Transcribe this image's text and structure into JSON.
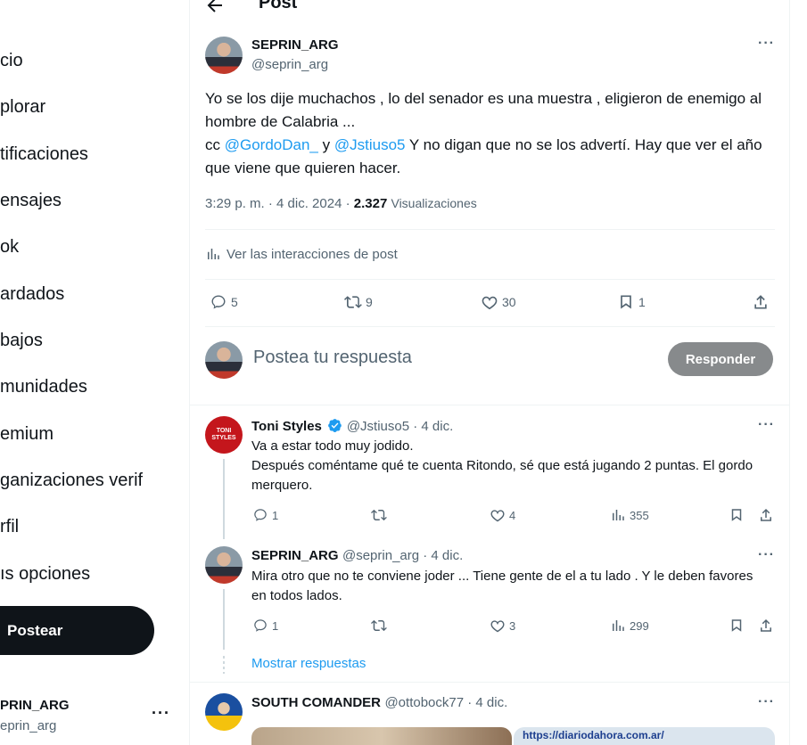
{
  "sidebar": {
    "items": [
      {
        "label": "Inicio",
        "visible": "cio"
      },
      {
        "label": "Explorar",
        "visible": "plorar"
      },
      {
        "label": "Notificaciones",
        "visible": "tificaciones"
      },
      {
        "label": "Mensajes",
        "visible": "ensajes"
      },
      {
        "label": "Grok",
        "visible": "ok"
      },
      {
        "label": "Guardados",
        "visible": "ardados"
      },
      {
        "label": "Trabajos",
        "visible": "bajos"
      },
      {
        "label": "Comunidades",
        "visible": "munidades"
      },
      {
        "label": "Premium",
        "visible": "emium"
      },
      {
        "label": "Organizaciones verif",
        "visible": "ganizaciones verif"
      },
      {
        "label": "Perfil",
        "visible": "rfil"
      },
      {
        "label": "Más opciones",
        "visible": "ıs opciones"
      }
    ],
    "post_button": "Postear",
    "account": {
      "name": "PRIN_ARG",
      "handle": "eprin_arg",
      "more": "···"
    }
  },
  "header": {
    "title": "Post"
  },
  "main_post": {
    "name": "SEPRIN_ARG",
    "handle": "@seprin_arg",
    "text_line1": "Yo se los dije muchachos , lo del senador es una muestra , eligieron de enemigo al hombre de Calabria ...",
    "text_cc": "cc",
    "mention1": "@GordoDan_",
    "text_y": "y",
    "mention2": "@Jstiuso5",
    "text_tail": "Y no digan que no se los advertí. Hay que ver el año que viene que quieren hacer.",
    "time": "3:29 p. m. · 4 dic. 2024 ·",
    "views_count": "2.327",
    "views_label": "Visualizaciones",
    "interactions_link": "Ver las interacciones de post",
    "stats": {
      "replies": "5",
      "reposts": "9",
      "likes": "30",
      "bookmarks": "1"
    }
  },
  "reply_box": {
    "placeholder": "Postea tu respuesta",
    "button": "Responder"
  },
  "replies": [
    {
      "name": "Toni Styles",
      "handle_date": "@Jstiuso5 · 4 dic.",
      "avatar_text": "TONI STYLES",
      "text": "Va a estar todo muy jodido.\nDespués coméntame qué te cuenta Ritondo, sé que está jugando 2 puntas. El gordo merquero.",
      "replies": "1",
      "reposts": "",
      "likes": "4",
      "views": "355"
    },
    {
      "name": "SEPRIN_ARG",
      "handle_date": "@seprin_arg · 4 dic.",
      "text": "Mira otro que no te conviene joder ... Tiene gente de el a tu lado . Y le deben favores en todos lados.",
      "replies": "1",
      "reposts": "",
      "likes": "3",
      "views": "299"
    }
  ],
  "show_replies": "Mostrar respuestas",
  "third_reply": {
    "name": "SOUTH COMANDER",
    "handle_date": "@ottobock77 · 4 dic.",
    "link_snippet": "https://diariodahora.com.ar/"
  },
  "colors": {
    "accent": "#1d9bf0",
    "text": "#0f1419",
    "muted": "#536471",
    "border": "#eff3f4"
  }
}
